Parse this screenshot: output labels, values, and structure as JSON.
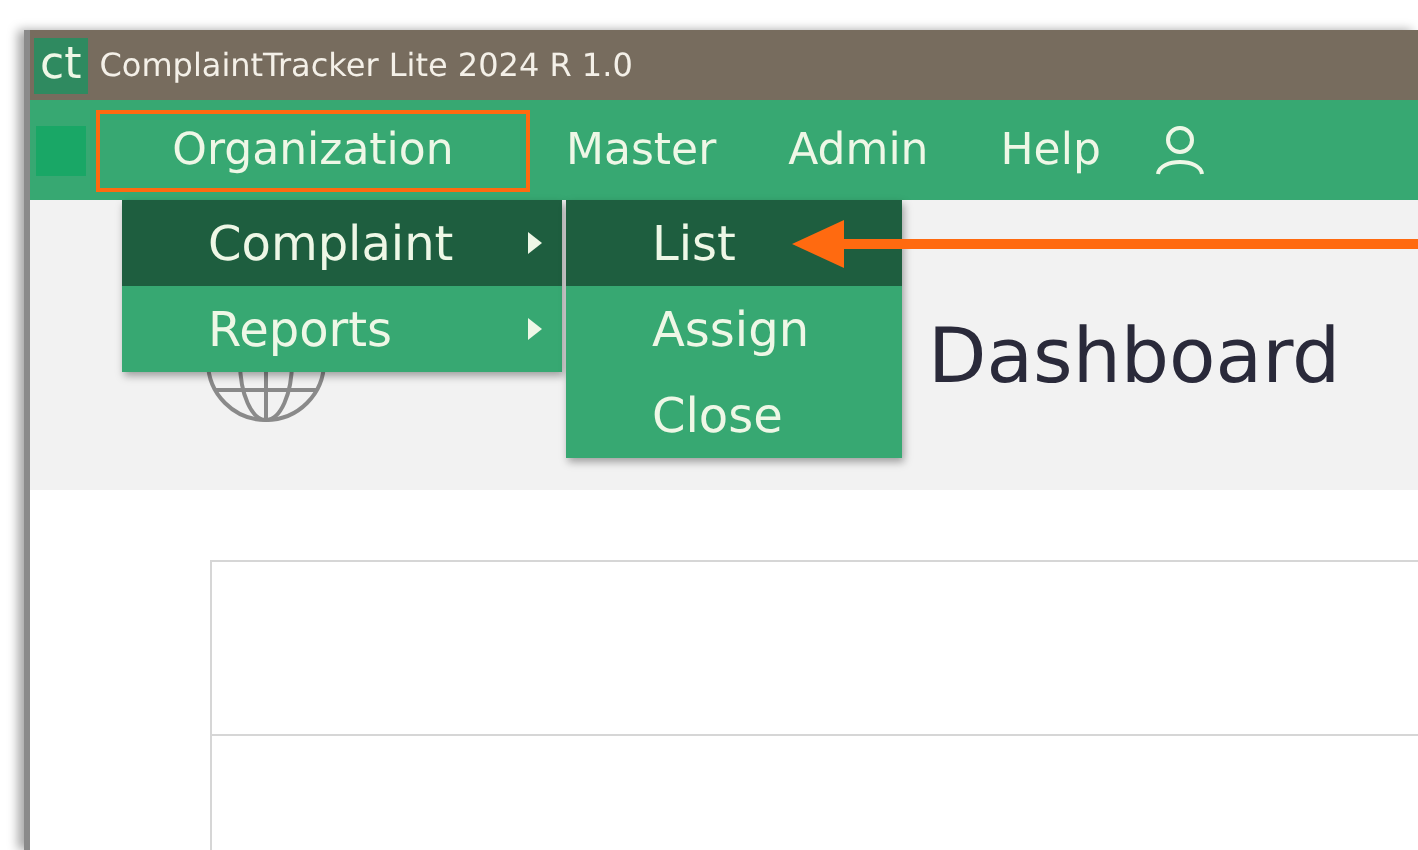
{
  "window": {
    "logo": "ct",
    "title": "ComplaintTracker Lite 2024 R 1.0"
  },
  "menu_bar": {
    "items": [
      {
        "label": "Organization",
        "selected": true
      },
      {
        "label": "Master",
        "selected": false
      },
      {
        "label": "Admin",
        "selected": false
      },
      {
        "label": "Help",
        "selected": false
      }
    ]
  },
  "dropdown": {
    "items": [
      {
        "label": "Complaint",
        "selected": true,
        "has_submenu": true
      },
      {
        "label": "Reports",
        "selected": false,
        "has_submenu": true
      }
    ]
  },
  "submenu": {
    "items": [
      {
        "label": "List",
        "selected": true
      },
      {
        "label": "Assign",
        "selected": false
      },
      {
        "label": "Close",
        "selected": false
      }
    ]
  },
  "page": {
    "heading_visible_end": "Dashboard"
  }
}
